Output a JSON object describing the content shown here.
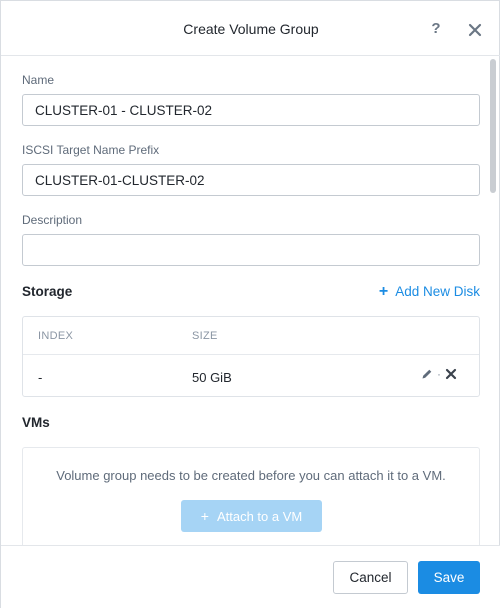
{
  "dialog": {
    "title": "Create Volume Group",
    "help_label": "?",
    "close_icon": "close-icon"
  },
  "form": {
    "name_label": "Name",
    "name_value": "CLUSTER-01 - CLUSTER-02",
    "iscsi_label": "ISCSI Target Name Prefix",
    "iscsi_value": "CLUSTER-01-CLUSTER-02",
    "description_label": "Description",
    "description_value": ""
  },
  "storage": {
    "title": "Storage",
    "add_disk_label": "Add New Disk",
    "columns": [
      "INDEX",
      "SIZE"
    ],
    "rows": [
      {
        "index": "-",
        "size": "50 GiB",
        "separator": "·"
      }
    ]
  },
  "vms": {
    "title": "VMs",
    "message": "Volume group needs to be created before you can attach it to a VM.",
    "attach_label": "Attach to a VM"
  },
  "footer": {
    "cancel_label": "Cancel",
    "save_label": "Save"
  },
  "colors": {
    "accent": "#1b8ce3",
    "accent_disabled": "#a6d4f5",
    "text": "#22272e",
    "muted": "#5f6b7a"
  }
}
